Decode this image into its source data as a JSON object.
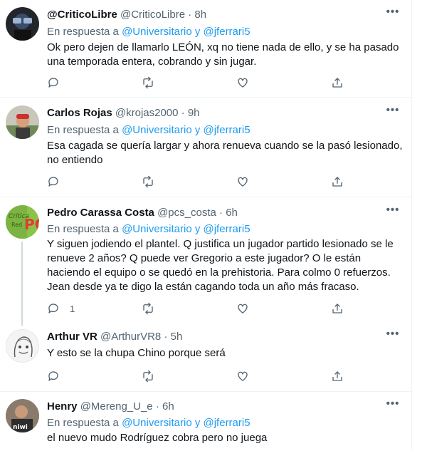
{
  "reply_prefix": "En respuesta a",
  "reply_to": "@Universitario y @jferrari5",
  "tweets": [
    {
      "name": "@CriticoLibre",
      "handle": "@CriticoLibre",
      "time": "8h",
      "text": "Ok pero dejen de llamarlo LEÓN, xq no tiene nada de ello, y se ha pasado una temporada entera, cobrando y sin jugar.",
      "reply_count": ""
    },
    {
      "name": "Carlos Rojas",
      "handle": "@krojas2000",
      "time": "9h",
      "text": "Esa cagada se quería largar y ahora renueva cuando se la pasó lesionado, no entiendo",
      "reply_count": ""
    },
    {
      "name": "Pedro Carassa Costa",
      "handle": "@pcs_costa",
      "time": "6h",
      "text": "Y siguen jodiendo el plantel. Q justifica un jugador partido lesionado se le renueve 2 años? Q puede ver Gregorio a este jugador? O le están haciendo el equipo o se quedó en la prehistoria. Para colmo 0 refuerzos. Jean desde ya te digo la están cagando toda un año más fracaso.",
      "reply_count": "1"
    },
    {
      "name": "Arthur VR",
      "handle": "@ArthurVR8",
      "time": "5h",
      "text": "Y esto se la chupa Chino porque será",
      "reply_count": ""
    },
    {
      "name": "Henry",
      "handle": "@Mereng_U_e",
      "time": "6h",
      "text": "el nuevo mudo Rodríguez cobra pero no juega",
      "reply_count": ""
    }
  ],
  "separator": "·",
  "more_glyph": "•••"
}
